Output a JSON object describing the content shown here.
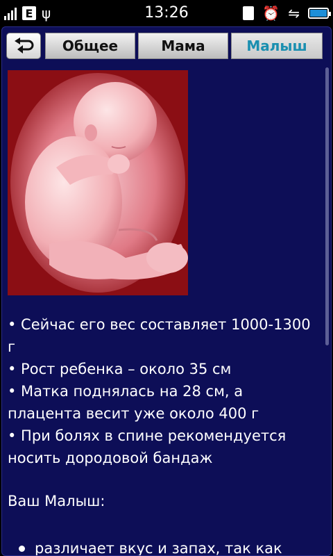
{
  "status_bar": {
    "network_badge": "E",
    "time": "13:26",
    "icons": [
      "signal-icon",
      "usb-icon",
      "sd-card-icon",
      "alarm-icon",
      "vibrate-icon",
      "battery-icon"
    ]
  },
  "tabs": [
    {
      "label": "Общее"
    },
    {
      "label": "Мама"
    },
    {
      "label": "Малыш",
      "active": true
    }
  ],
  "facts": [
    "• Сейчас его вес составляет 1000-1300 г",
    "• Рост ребенка – около 35 см",
    "• Матка поднялась на 28 см, а плацента весит уже около 400 г",
    "• При болях в спине рекомендуется носить дородовой бандаж"
  ],
  "baby_section": {
    "heading": "Ваш Малыш:",
    "items": [
      "различает вкус и запах, так как"
    ]
  },
  "colors": {
    "background": "#0d0e57",
    "active_tab_text": "#1a8fb0",
    "image_bg": "#8b0e14"
  }
}
